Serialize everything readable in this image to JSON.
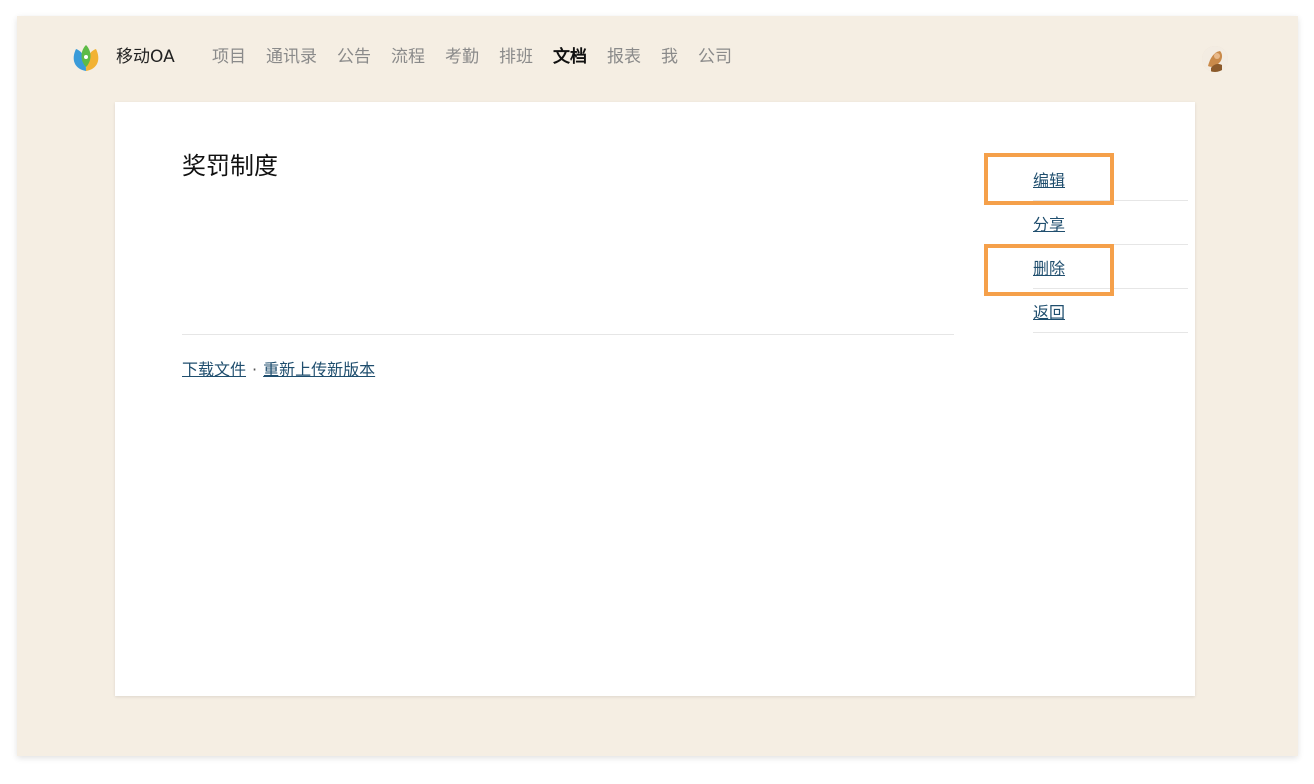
{
  "header": {
    "app_name": "移动OA",
    "nav_items": [
      {
        "label": "项目",
        "active": false
      },
      {
        "label": "通讯录",
        "active": false
      },
      {
        "label": "公告",
        "active": false
      },
      {
        "label": "流程",
        "active": false
      },
      {
        "label": "考勤",
        "active": false
      },
      {
        "label": "排班",
        "active": false
      },
      {
        "label": "文档",
        "active": true
      },
      {
        "label": "报表",
        "active": false
      },
      {
        "label": "我",
        "active": false
      },
      {
        "label": "公司",
        "active": false
      }
    ],
    "logo_icon": "leaf-logo-icon",
    "avatar_icon": "user-avatar"
  },
  "document": {
    "title": "奖罚制度",
    "download_label": "下载文件",
    "separator": "·",
    "reupload_label": "重新上传新版本"
  },
  "actions": {
    "edit": "编辑",
    "share": "分享",
    "delete": "删除",
    "back": "返回"
  },
  "colors": {
    "background": "#f5eee3",
    "link": "#1f4e6e",
    "highlight": "#f5a04a",
    "active_nav": "#111111",
    "inactive_nav": "#8a8a8a"
  }
}
